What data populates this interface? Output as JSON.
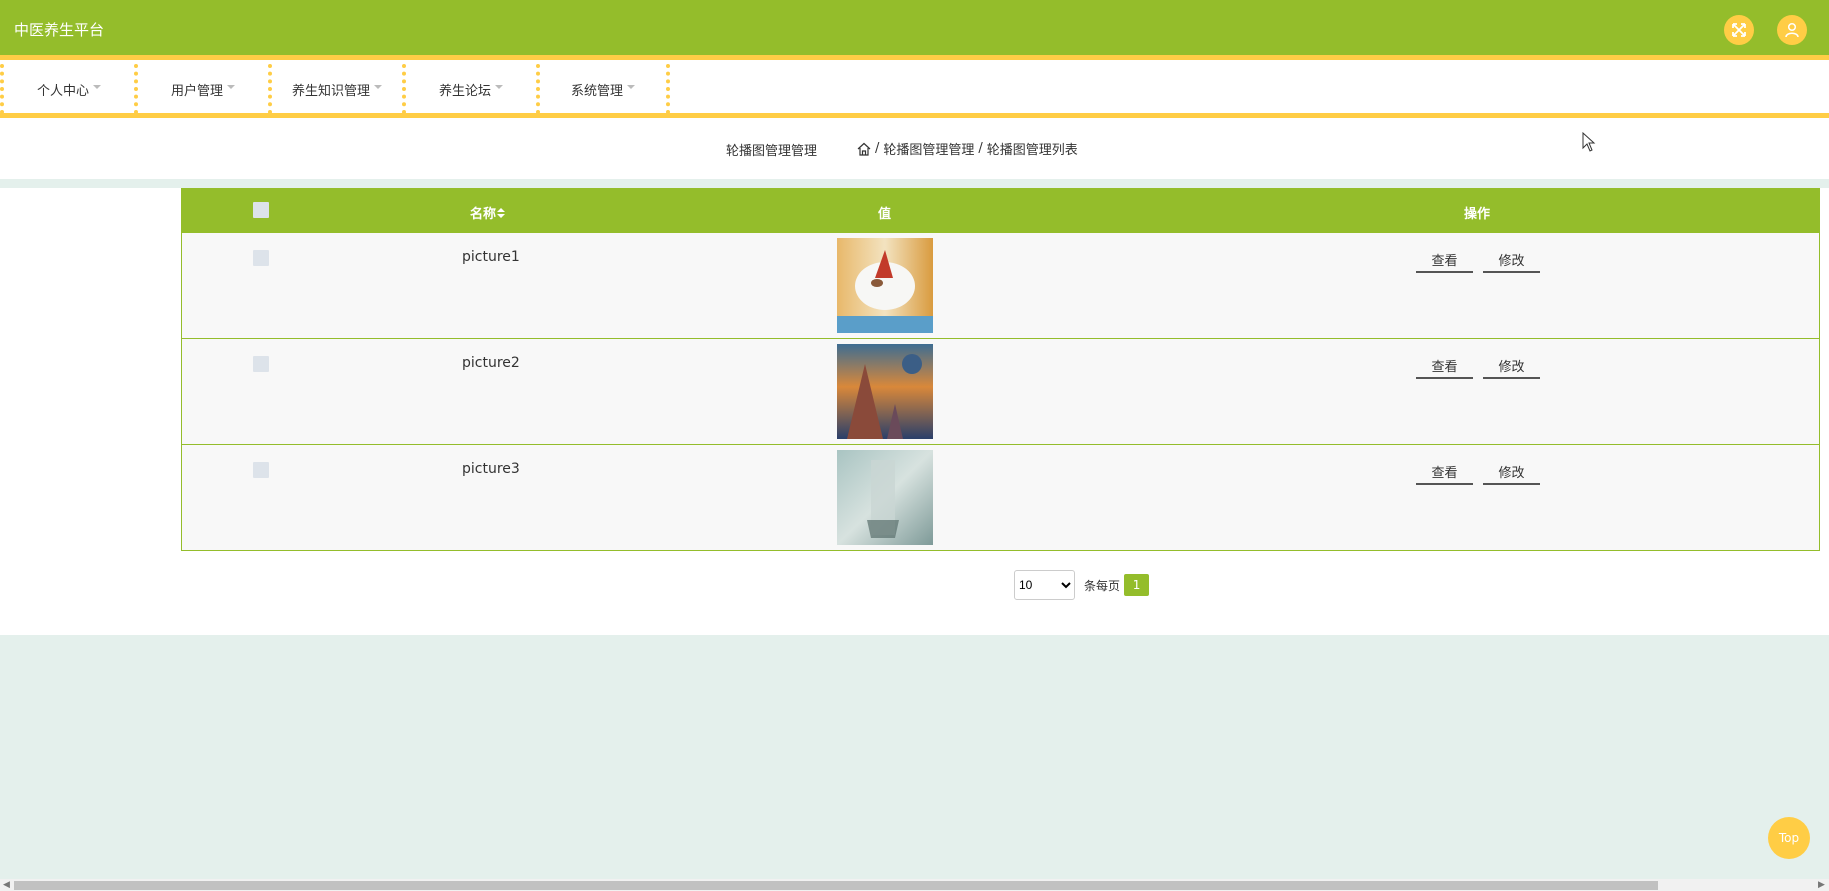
{
  "app": {
    "title": "中医养生平台"
  },
  "header": {
    "icons": [
      "fullscreen-icon",
      "user-icon"
    ]
  },
  "nav": {
    "items": [
      {
        "label": "个人中心"
      },
      {
        "label": "用户管理"
      },
      {
        "label": "养生知识管理"
      },
      {
        "label": "养生论坛"
      },
      {
        "label": "系统管理"
      }
    ]
  },
  "breadcrumb": {
    "title": "轮播图管理管理",
    "sep": "/",
    "level1": "轮播图管理管理",
    "level2": "轮播图管理列表"
  },
  "table": {
    "headers": {
      "name": "名称",
      "value": "值",
      "ops": "操作"
    },
    "rows": [
      {
        "name": "picture1",
        "view": "查看",
        "edit": "修改"
      },
      {
        "name": "picture2",
        "view": "查看",
        "edit": "修改"
      },
      {
        "name": "picture3",
        "view": "查看",
        "edit": "修改"
      }
    ]
  },
  "pager": {
    "page_size": "10",
    "per_page_label": "条每页",
    "current_page": "1"
  },
  "back_to_top": "Top",
  "colors": {
    "primary": "#94bd2b",
    "accent": "#ffcd45",
    "background": "#e4f0ec"
  }
}
